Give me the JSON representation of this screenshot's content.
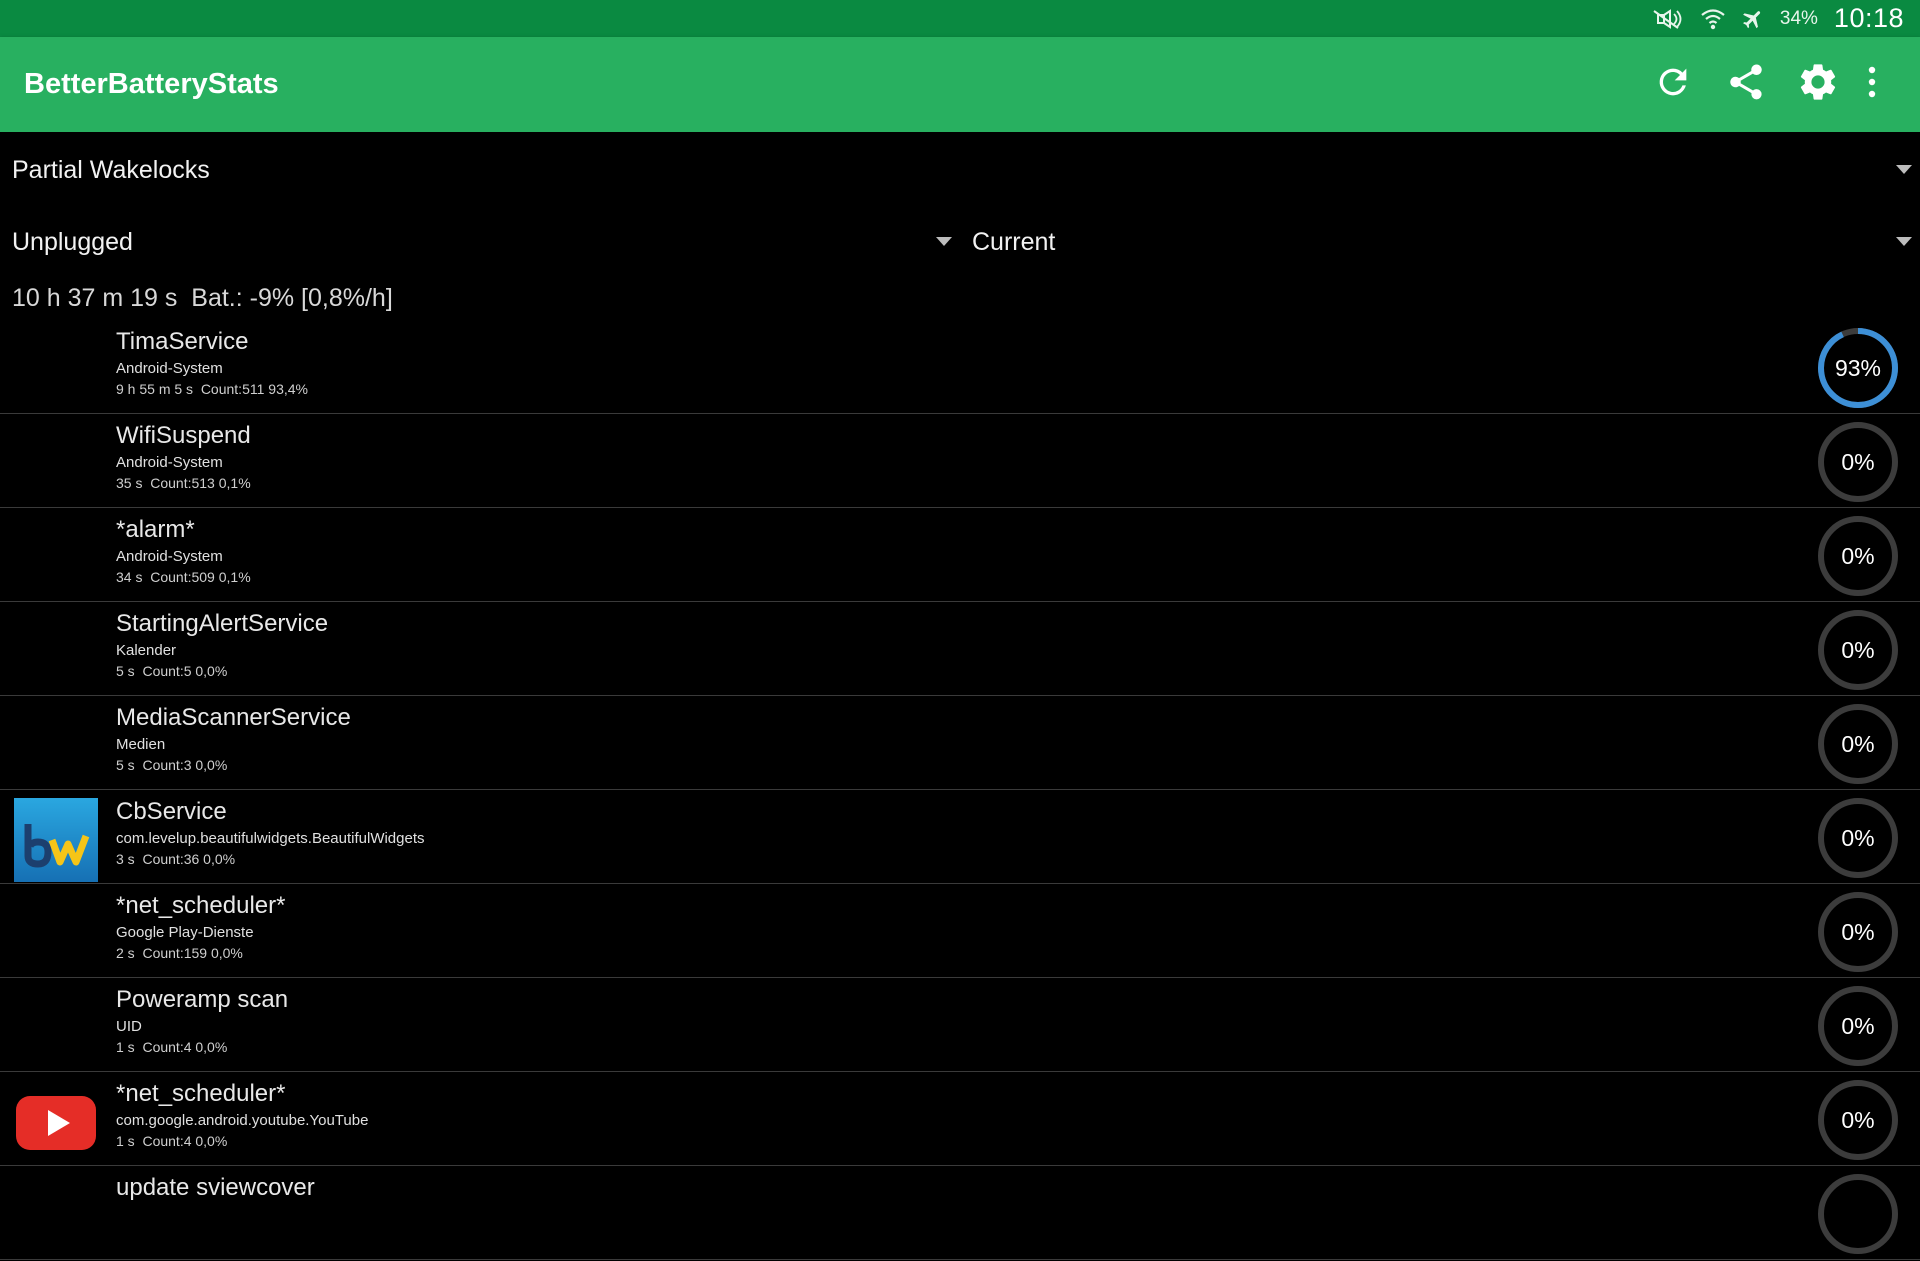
{
  "status_bar": {
    "battery": "34%",
    "time": "10:18",
    "icons": [
      "mute-icon",
      "wifi-icon",
      "airplane-icon"
    ]
  },
  "toolbar": {
    "title": "BetterBatteryStats",
    "actions": [
      "refresh-icon",
      "share-icon",
      "settings-icon",
      "overflow-menu-icon"
    ],
    "accent_color": "#28b060"
  },
  "filters": {
    "stat_type": "Partial Wakelocks",
    "from": "Unplugged",
    "to": "Current"
  },
  "summary": "10 h 37 m 19 s  Bat.: -9% [0,8%/h]",
  "wakelocks": [
    {
      "name": "TimaService",
      "package": "Android-System",
      "stats": "9 h 55 m 5 s  Count:511 93,4%",
      "percent": 93,
      "pct_label": "93%",
      "icon": "none"
    },
    {
      "name": "WifiSuspend",
      "package": "Android-System",
      "stats": "35 s  Count:513 0,1%",
      "percent": 0,
      "pct_label": "0%",
      "icon": "none"
    },
    {
      "name": "*alarm*",
      "package": "Android-System",
      "stats": "34 s  Count:509 0,1%",
      "percent": 0,
      "pct_label": "0%",
      "icon": "none"
    },
    {
      "name": "StartingAlertService",
      "package": "Kalender",
      "stats": "5 s  Count:5 0,0%",
      "percent": 0,
      "pct_label": "0%",
      "icon": "none"
    },
    {
      "name": "MediaScannerService",
      "package": "Medien",
      "stats": "5 s  Count:3 0,0%",
      "percent": 0,
      "pct_label": "0%",
      "icon": "none"
    },
    {
      "name": "CbService",
      "package": "com.levelup.beautifulwidgets.BeautifulWidgets",
      "stats": "3 s  Count:36 0,0%",
      "percent": 0,
      "pct_label": "0%",
      "icon": "beautiful-widgets-icon"
    },
    {
      "name": "*net_scheduler*",
      "package": "Google Play-Dienste",
      "stats": "2 s  Count:159 0,0%",
      "percent": 0,
      "pct_label": "0%",
      "icon": "none"
    },
    {
      "name": "Poweramp scan",
      "package": "UID",
      "stats": "1 s  Count:4 0,0%",
      "percent": 0,
      "pct_label": "0%",
      "icon": "none"
    },
    {
      "name": "*net_scheduler*",
      "package": "com.google.android.youtube.YouTube",
      "stats": "1 s  Count:4 0,0%",
      "percent": 0,
      "pct_label": "0%",
      "icon": "youtube-icon"
    },
    {
      "name": "update sviewcover",
      "package": "",
      "stats": "",
      "percent": 0,
      "pct_label": "",
      "icon": "none"
    }
  ],
  "colors": {
    "gauge_track": "#3c3c3c",
    "gauge_fill": "#3d8fd6",
    "youtube_red": "#e52d27",
    "bw_blue": "#1a86c8"
  }
}
